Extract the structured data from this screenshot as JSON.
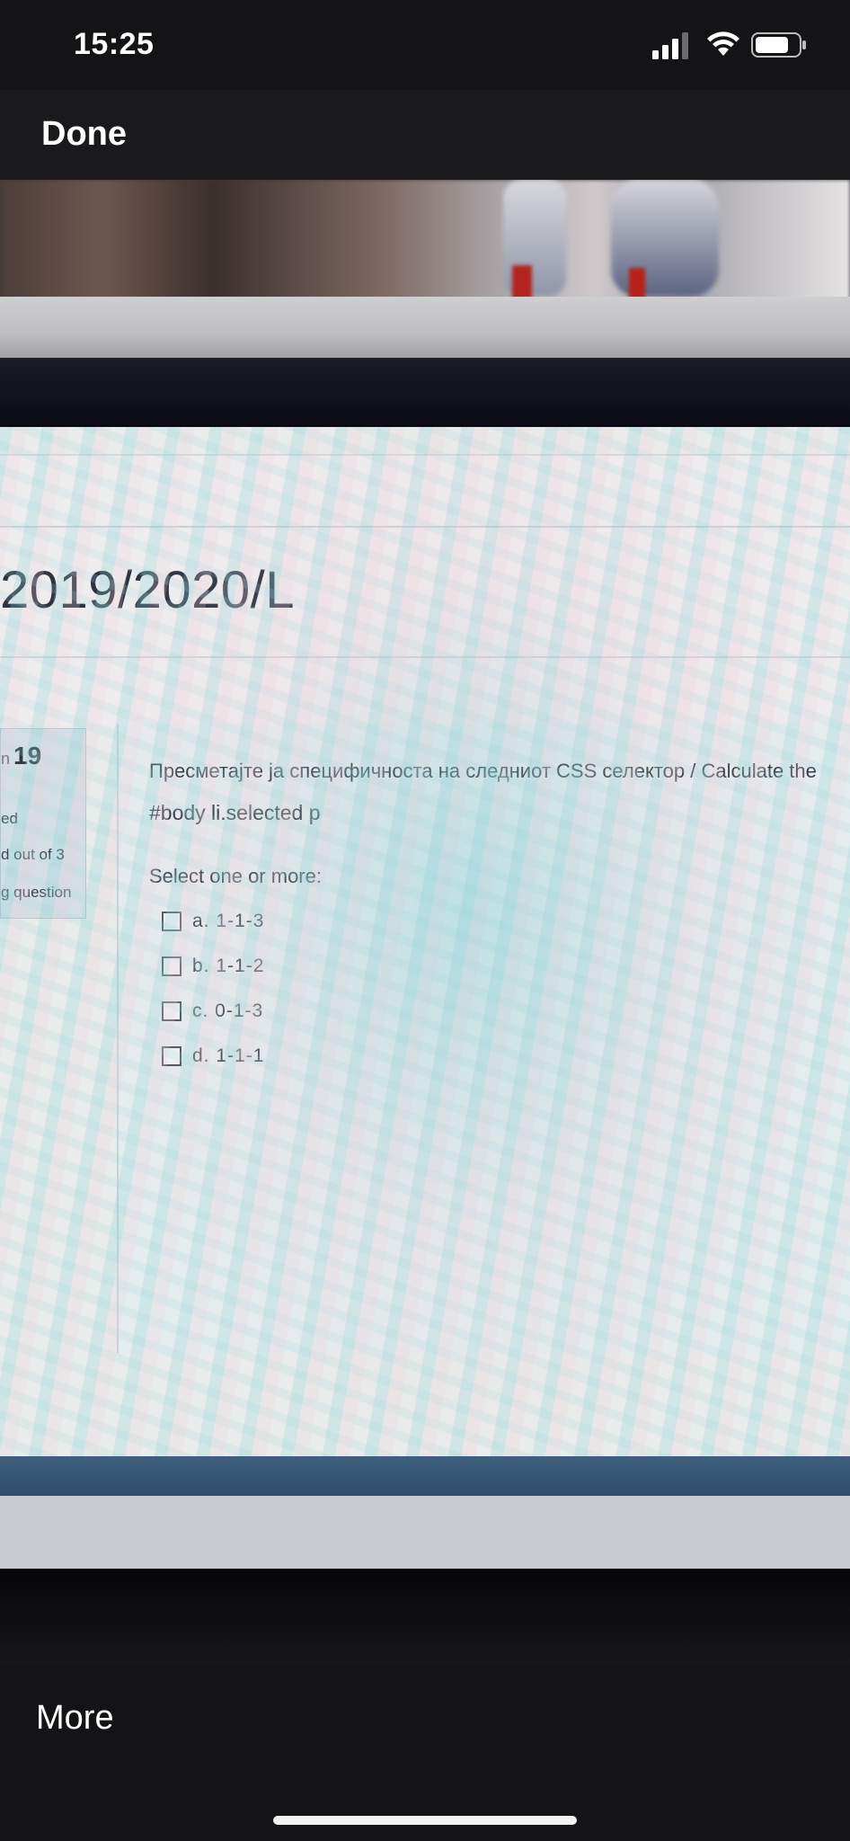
{
  "status_bar": {
    "time": "15:25",
    "signal_icon": "cellular-signal-icon",
    "wifi_icon": "wifi-icon",
    "battery_icon": "battery-icon"
  },
  "nav": {
    "done_label": "Done"
  },
  "photo": {
    "course_title": "2019/2020/L",
    "info_box": {
      "question_prefix": "n",
      "question_number": "19",
      "line_1": "ed",
      "line_2": "d out of 3",
      "line_3": "g question"
    },
    "question": {
      "text": "Пресметајте ја специфичноста на следниот CSS селектор / Calculate the",
      "selector": "#body li.selected p",
      "prompt": "Select one or more:",
      "options": [
        {
          "label": "a. 1-1-3"
        },
        {
          "label": "b. 1-1-2"
        },
        {
          "label": "c. 0-1-3"
        },
        {
          "label": "d. 1-1-1"
        }
      ]
    }
  },
  "toolbar": {
    "more_label": "More"
  }
}
